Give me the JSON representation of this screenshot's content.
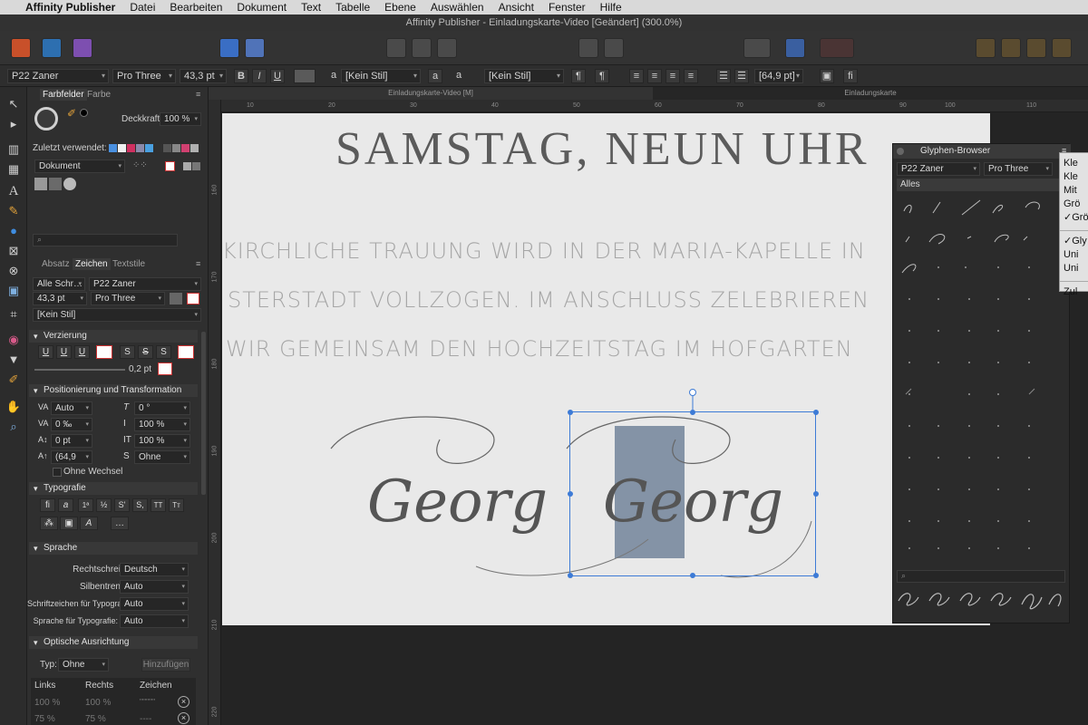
{
  "menubar": {
    "app": "Affinity Publisher",
    "items": [
      "Datei",
      "Bearbeiten",
      "Dokument",
      "Text",
      "Tabelle",
      "Ebene",
      "Auswählen",
      "Ansicht",
      "Fenster",
      "Hilfe"
    ]
  },
  "window_title": "Affinity Publisher - Einladungskarte-Video [Geändert] (300.0%)",
  "context_bar": {
    "font": "P22 Zaner",
    "style": "Pro Three",
    "size": "43,3 pt",
    "bold": "B",
    "italic": "I",
    "underline": "U",
    "char_style": "[Kein Stil]",
    "para_style": "[Kein Stil]",
    "baseline": "[64,9 pt]"
  },
  "doc_tabs": {
    "left": "Einladungskarte-Video [M]",
    "right": "Einladungskarte"
  },
  "panel": {
    "tabs": {
      "farbfelder": "Farbfelder",
      "farbe": "Farbe"
    },
    "opacity_label": "Deckkraft:",
    "opacity_value": "100 %",
    "recent_label": "Zuletzt verwendet:",
    "document_select": "Dokument",
    "char_tabs": {
      "absatz": "Absatz",
      "zeichen": "Zeichen",
      "textstile": "Textstile"
    },
    "font_collection": "Alle Schr…",
    "font_name": "P22 Zaner",
    "font_size": "43,3 pt",
    "font_style": "Pro Three",
    "char_style": "[Kein Stil]",
    "sections": {
      "verzierung": "Verzierung",
      "position": "Positionierung und Transformation",
      "typografie": "Typografie",
      "sprache": "Sprache",
      "optische": "Optische Ausrichtung"
    },
    "decor_buttons": [
      "U",
      "U",
      "U",
      "S",
      "S",
      "S"
    ],
    "stroke_value": "0,2 pt",
    "position_fields": {
      "kerning": "Auto",
      "tracking": "0 ‰",
      "baseline": "0 pt",
      "leading": "(64,9",
      "skew": "0 °",
      "vscale": "100 %",
      "hscale": "100 %",
      "case": "Ohne"
    },
    "no_change": "Ohne Wechsel",
    "typo_buttons": [
      "fi",
      "a",
      "1ª",
      "½",
      "S'",
      "S,",
      "TT",
      "Tт"
    ],
    "more_button": "…",
    "language": {
      "spell_label": "Rechtschreibung:",
      "spell_value": "Deutsch",
      "hyph_label": "Silbentrennung:",
      "hyph_value": "Auto",
      "typo_font_label": "Schriftzeichen für Typografie:",
      "typo_font_value": "Auto",
      "typo_lang_label": "Sprache für Typografie:",
      "typo_lang_value": "Auto"
    },
    "optical": {
      "type_label": "Typ:",
      "type_value": "Ohne",
      "add_button": "Hinzufügen",
      "col_left": "Links",
      "col_right": "Rechts",
      "col_char": "Zeichen",
      "row1_left": "100 %",
      "row1_right": "100 %",
      "row1_char": "\"\"\"\"\"\"",
      "row2_left": "75 %",
      "row2_right": "75 %",
      "row2_char": "----"
    }
  },
  "ruler": {
    "h_ticks": [
      "mm",
      "10",
      "20",
      "30",
      "40",
      "50",
      "60",
      "70",
      "80",
      "90",
      "100",
      "110"
    ],
    "v_ticks": [
      "160",
      "170",
      "180",
      "190",
      "200",
      "210",
      "220"
    ]
  },
  "canvas": {
    "title": "SAMSTAG, NEUN UHR",
    "lines": [
      "KIRCHLICHE TRAUUNG WIRD IN DER MARIA-KAPELLE IN",
      "STERSTADT VOLLZOGEN. IM ANSCHLUSS ZELEBRIEREN",
      "WIR  GEMEINSAM DEN HOCHZEITSTAG IM HOFGARTEN"
    ],
    "name1": "Georg",
    "name2": "Georg"
  },
  "glyph_browser": {
    "title": "Glyphen-Browser",
    "font": "P22 Zaner",
    "style": "Pro Three",
    "filter": "Alles"
  },
  "context_menu": {
    "items": [
      "Kle",
      "Kle",
      "Mit",
      "Grö",
      "Grö",
      "Gly",
      "Uni",
      "Uni",
      "Zul"
    ]
  },
  "colors": {
    "accent": "#3d7bd6",
    "selection_fill": "#8493a6"
  }
}
